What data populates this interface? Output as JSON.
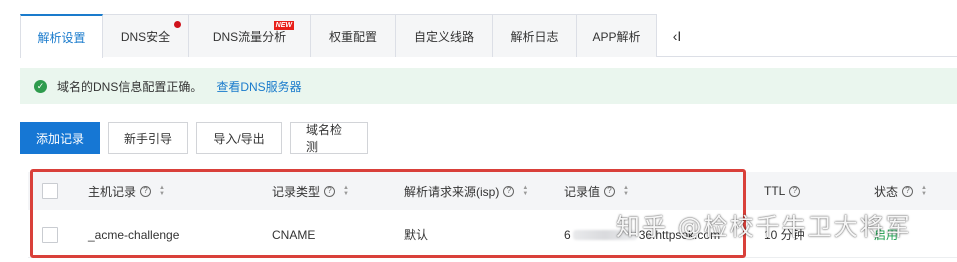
{
  "tabs": [
    {
      "label": "解析设置"
    },
    {
      "label": "DNS安全"
    },
    {
      "label": "DNS流量分析",
      "badge": "NEW"
    },
    {
      "label": "权重配置"
    },
    {
      "label": "自定义线路"
    },
    {
      "label": "解析日志"
    },
    {
      "label": "APP解析"
    }
  ],
  "tabs_more": "‹I",
  "alert": {
    "message": "域名的DNS信息配置正确。",
    "link": "查看DNS服务器"
  },
  "toolbar": {
    "add_record": "添加记录",
    "beginner_guide": "新手引导",
    "import_export": "导入/导出",
    "domain_check": "域名检测"
  },
  "table": {
    "headers": {
      "host": "主机记录",
      "type": "记录类型",
      "isp": "解析请求来源(isp)",
      "value": "记录值",
      "ttl": "TTL",
      "status": "状态"
    },
    "rows": [
      {
        "host": "_acme-challenge",
        "type": "CNAME",
        "isp": "默认",
        "value_prefix": "6",
        "value_suffix": "36.httpsok.com",
        "ttl": "10 分钟",
        "status": "启用"
      }
    ]
  },
  "watermark": "知乎 @检校千牛卫大将军",
  "colors": {
    "accent": "#1677d4",
    "highlight": "#d9403a",
    "success": "#2e9b4d"
  }
}
